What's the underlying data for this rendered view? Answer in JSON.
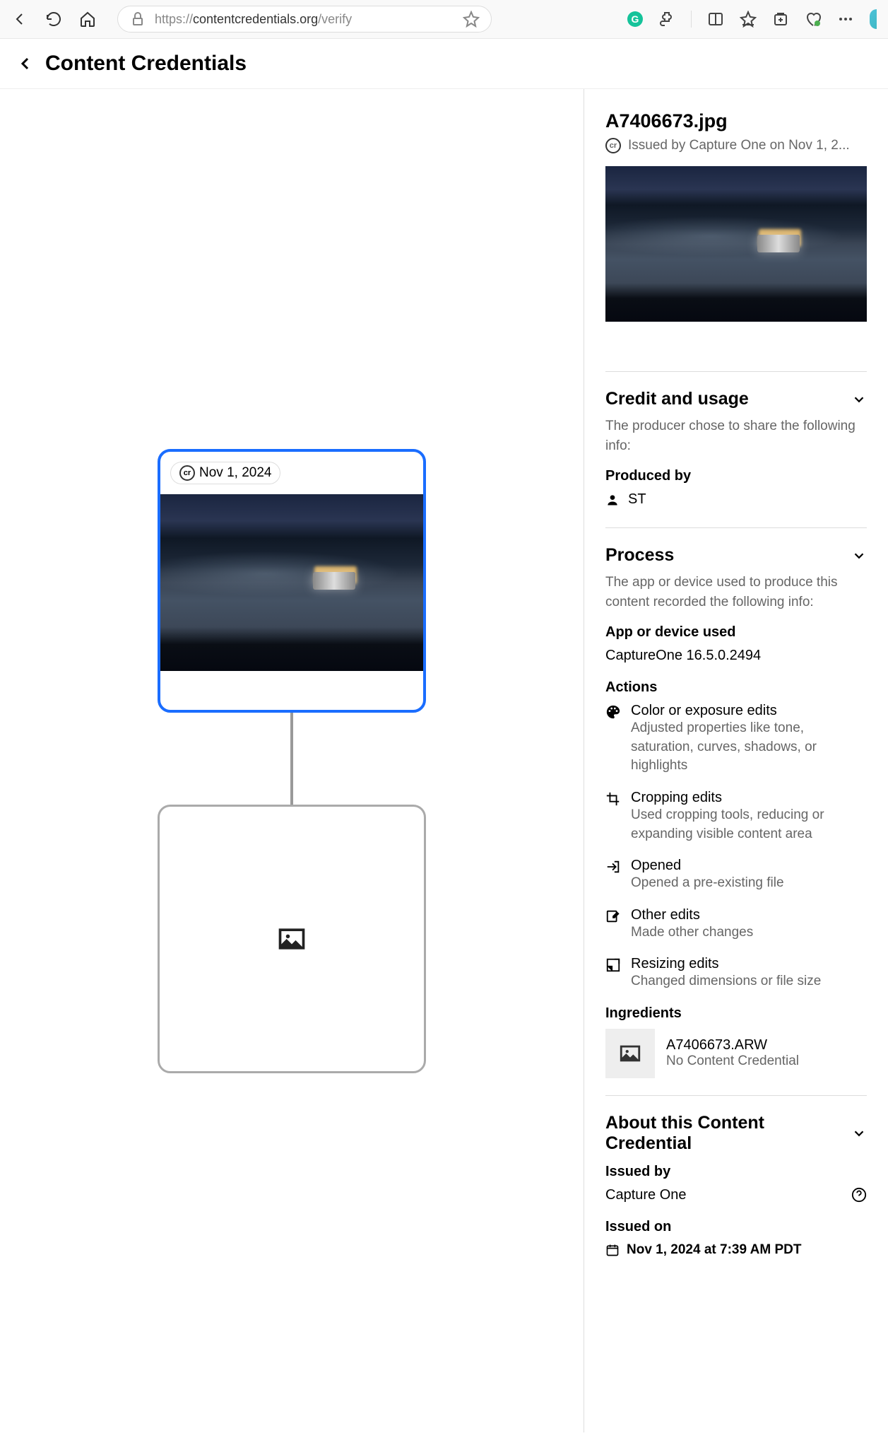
{
  "browser": {
    "url_prefix": "https://",
    "url_domain": "contentcredentials.org",
    "url_path": "/verify"
  },
  "header": {
    "title": "Content Credentials"
  },
  "graph": {
    "active_date": "Nov 1, 2024"
  },
  "detail": {
    "filename": "A7406673.jpg",
    "issued_line": "Issued by Capture One on Nov 1, 2...",
    "credit": {
      "title": "Credit and usage",
      "desc": "The producer chose to share the following info:",
      "produced_by_label": "Produced by",
      "producer": "ST"
    },
    "process": {
      "title": "Process",
      "desc": "The app or device used to produce this content recorded the following info:",
      "app_label": "App or device used",
      "app_name": "CaptureOne 16.5.0.2494",
      "actions_label": "Actions",
      "actions": [
        {
          "icon": "palette",
          "title": "Color or exposure edits",
          "desc": "Adjusted properties like tone, saturation, curves, shadows, or highlights"
        },
        {
          "icon": "crop",
          "title": "Cropping edits",
          "desc": "Used cropping tools, reducing or expanding visible content area"
        },
        {
          "icon": "open",
          "title": "Opened",
          "desc": "Opened a pre-existing file"
        },
        {
          "icon": "edit",
          "title": "Other edits",
          "desc": "Made other changes"
        },
        {
          "icon": "resize",
          "title": "Resizing edits",
          "desc": "Changed dimensions or file size"
        }
      ],
      "ingredients_label": "Ingredients",
      "ingredient_name": "A7406673.ARW",
      "ingredient_sub": "No Content Credential"
    },
    "about": {
      "title": "About this Content Credential",
      "issued_by_label": "Issued by",
      "issued_by": "Capture One",
      "issued_on_label": "Issued on",
      "issued_on": "Nov 1, 2024 at 7:39 AM PDT"
    }
  }
}
